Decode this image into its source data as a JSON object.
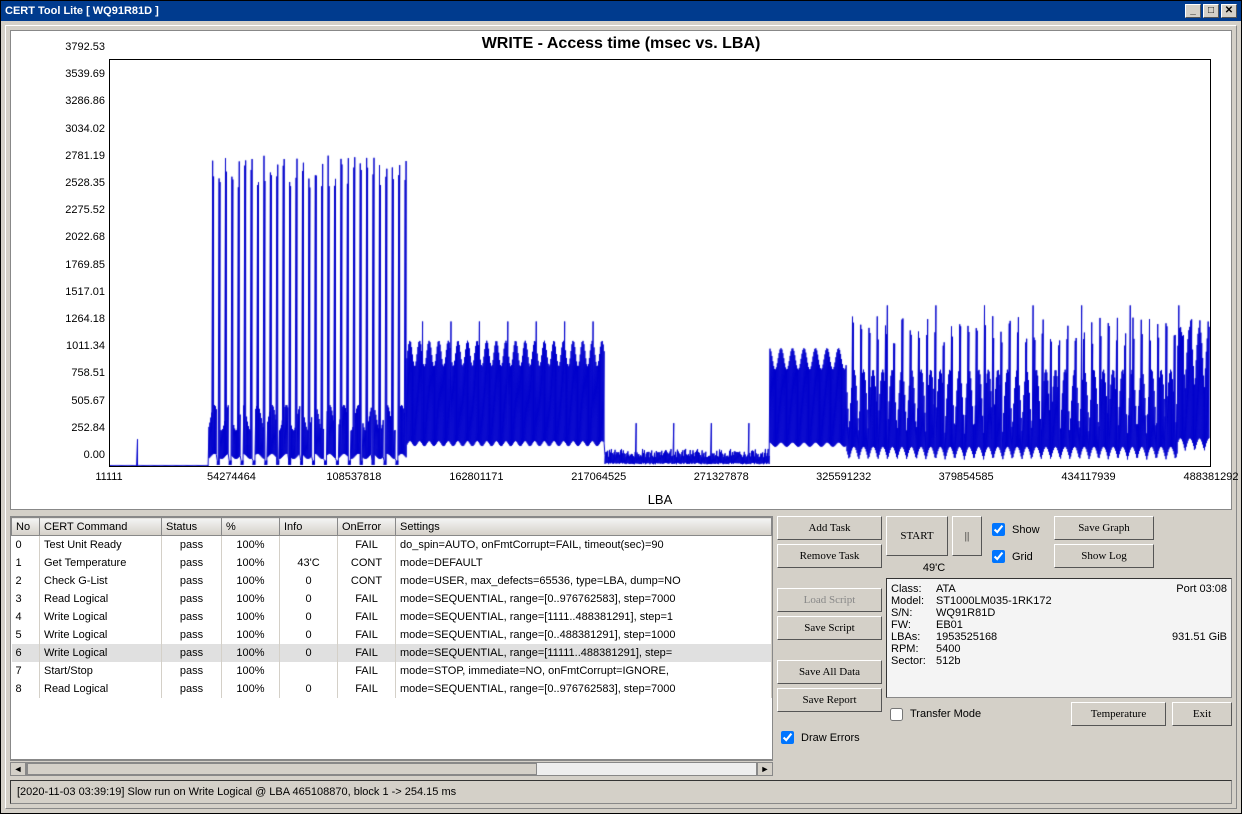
{
  "window": {
    "title": "CERT Tool Lite [ WQ91R81D ]"
  },
  "chart_data": {
    "type": "line",
    "title": "WRITE - Access time (msec vs. LBA)",
    "xlabel": "LBA",
    "ylabel": "",
    "ylim": [
      0,
      3792.53
    ],
    "xlim": [
      11111,
      488381292
    ],
    "y_ticks": [
      "0.00",
      "252.84",
      "505.67",
      "758.51",
      "1011.34",
      "1264.18",
      "1517.01",
      "1769.85",
      "2022.68",
      "2275.52",
      "2528.35",
      "2781.19",
      "3034.02",
      "3286.86",
      "3539.69",
      "3792.53"
    ],
    "x_ticks": [
      "11111",
      "54274464",
      "108537818",
      "162801171",
      "217064525",
      "271327878",
      "325591232",
      "379854585",
      "434117939",
      "488381292"
    ],
    "series_note": "Dense access-time trace; approximate envelope reconstructed. Early region ~LBA 11111–54M mostly near 0 with one ~250ms spike. LBA 54M–135M: many tall spikes 2500–2900ms interleaved with 400–700ms plateau. LBA 135M–225M: sustained ~1000–1200ms band. LBA 225M–300M: drops to ~50–150ms with occasional 400ms spikes. LBA 300M–335M: ~1000ms band. LBA 335M–488M: ragged 200–1200ms with spikes to ~1500ms, rising toward end."
  },
  "table": {
    "headers": [
      "No",
      "CERT Command",
      "Status",
      "%",
      "Info",
      "OnError",
      "Settings"
    ],
    "rows": [
      {
        "no": "0",
        "cmd": "Test Unit Ready",
        "status": "pass",
        "pct": "100%",
        "info": "",
        "onerr": "FAIL",
        "settings": "do_spin=AUTO, onFmtCorrupt=FAIL, timeout(sec)=90"
      },
      {
        "no": "1",
        "cmd": "Get Temperature",
        "status": "pass",
        "pct": "100%",
        "info": "43'C",
        "onerr": "CONT",
        "settings": "mode=DEFAULT"
      },
      {
        "no": "2",
        "cmd": "Check G-List",
        "status": "pass",
        "pct": "100%",
        "info": "0",
        "onerr": "CONT",
        "settings": "mode=USER, max_defects=65536, type=LBA, dump=NO"
      },
      {
        "no": "3",
        "cmd": "Read Logical",
        "status": "pass",
        "pct": "100%",
        "info": "0",
        "onerr": "FAIL",
        "settings": "mode=SEQUENTIAL, range=[0..976762583], step=7000"
      },
      {
        "no": "4",
        "cmd": "Write Logical",
        "status": "pass",
        "pct": "100%",
        "info": "0",
        "onerr": "FAIL",
        "settings": "mode=SEQUENTIAL, range=[1111..488381291], step=1"
      },
      {
        "no": "5",
        "cmd": "Write Logical",
        "status": "pass",
        "pct": "100%",
        "info": "0",
        "onerr": "FAIL",
        "settings": "mode=SEQUENTIAL, range=[0..488381291], step=1000"
      },
      {
        "no": "6",
        "cmd": "Write Logical",
        "status": "pass",
        "pct": "100%",
        "info": "0",
        "onerr": "FAIL",
        "settings": "mode=SEQUENTIAL, range=[11111..488381291], step=",
        "selected": true
      },
      {
        "no": "7",
        "cmd": "Start/Stop",
        "status": "pass",
        "pct": "100%",
        "info": "",
        "onerr": "FAIL",
        "settings": "mode=STOP, immediate=NO, onFmtCorrupt=IGNORE,"
      },
      {
        "no": "8",
        "cmd": "Read Logical",
        "status": "pass",
        "pct": "100%",
        "info": "0",
        "onerr": "FAIL",
        "settings": "mode=SEQUENTIAL, range=[0..976762583], step=7000"
      }
    ]
  },
  "buttons": {
    "add_task": "Add Task",
    "remove_task": "Remove Task",
    "load_script": "Load Script",
    "save_script": "Save Script",
    "save_all": "Save All Data",
    "save_report": "Save Report",
    "start": "START",
    "pause": "||",
    "save_graph": "Save Graph",
    "show_log": "Show Log",
    "temperature": "Temperature",
    "exit": "Exit"
  },
  "checks": {
    "show": "Show",
    "grid": "Grid",
    "draw_errors": "Draw Errors",
    "transfer_mode": "Transfer Mode"
  },
  "temp_reading": "49'C",
  "drive_info": {
    "class_k": "Class:",
    "class_v": "ATA",
    "port": "Port 03:08",
    "model_k": "Model:",
    "model_v": "ST1000LM035-1RK172",
    "sn_k": "S/N:",
    "sn_v": "WQ91R81D",
    "fw_k": "FW:",
    "fw_v": "EB01",
    "lbas_k": "LBAs:",
    "lbas_v": "1953525168",
    "size": "931.51 GiB",
    "rpm_k": "RPM:",
    "rpm_v": "5400",
    "sector_k": "Sector:",
    "sector_v": "512b"
  },
  "status": "[2020-11-03 03:39:19] Slow run on Write Logical @ LBA 465108870, block 1 -> 254.15 ms"
}
